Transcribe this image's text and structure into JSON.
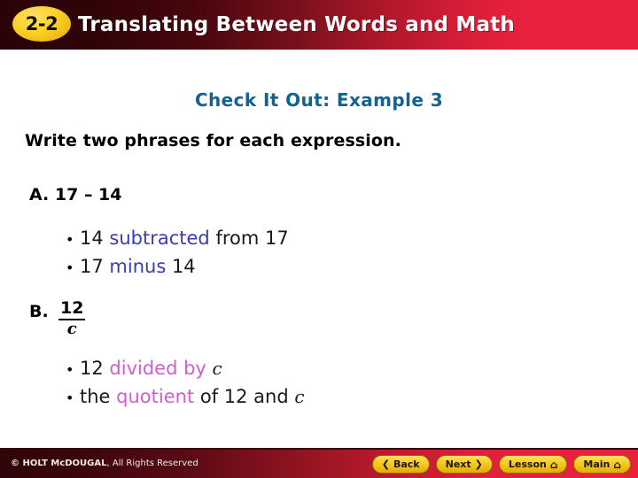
{
  "header": {
    "lesson_number": "2-2",
    "title": "Translating Between Words and Math",
    "gradient_dark": "#2a0306",
    "gradient_bright": "#e8213c",
    "badge_color": "#fcd12a"
  },
  "slide": {
    "example_heading": "Check It Out: Example 3",
    "example_heading_color": "#12638f",
    "instruction": "Write two phrases for each expression.",
    "problems": [
      {
        "label": "A. 17 – 14",
        "expression_type": "inline",
        "phrases": [
          {
            "bullet": "•",
            "parts": [
              {
                "text": "14 ",
                "style": "plain"
              },
              {
                "text": "subtracted",
                "style": "keyword-blue"
              },
              {
                "text": " from 17",
                "style": "plain"
              }
            ]
          },
          {
            "bullet": "•",
            "parts": [
              {
                "text": "17 ",
                "style": "plain"
              },
              {
                "text": "minus",
                "style": "keyword-blue"
              },
              {
                "text": " 14",
                "style": "plain"
              }
            ]
          }
        ]
      },
      {
        "label": "B.",
        "expression_type": "fraction",
        "numerator": "12",
        "denominator": "c",
        "phrases": [
          {
            "bullet": "•",
            "parts": [
              {
                "text": "12 ",
                "style": "plain"
              },
              {
                "text": "divided by",
                "style": "keyword-pink"
              },
              {
                "text": " ",
                "style": "plain"
              },
              {
                "text": "c",
                "style": "variable"
              }
            ]
          },
          {
            "bullet": "•",
            "parts": [
              {
                "text": "the ",
                "style": "plain"
              },
              {
                "text": "quotient",
                "style": "keyword-pink"
              },
              {
                "text": " of 12 and ",
                "style": "plain"
              },
              {
                "text": "c",
                "style": "variable"
              }
            ]
          }
        ]
      }
    ],
    "keyword_blue": "#3b3bb0",
    "keyword_pink": "#cf5fcf"
  },
  "footer": {
    "copyright_brand": "© HOLT McDOUGAL",
    "copyright_rest": ", All Rights Reserved",
    "buttons": [
      {
        "label": "Back",
        "glyph": "❮",
        "glyph_side": "left",
        "icon": "chevron-left-icon"
      },
      {
        "label": "Next",
        "glyph": "❯",
        "glyph_side": "right",
        "icon": "chevron-right-icon"
      },
      {
        "label": "Lesson",
        "glyph": "⌂",
        "glyph_side": "right",
        "icon": "home-icon"
      },
      {
        "label": "Main",
        "glyph": "⌂",
        "glyph_side": "right",
        "icon": "home-icon"
      }
    ],
    "button_color": "#f6c81d"
  }
}
